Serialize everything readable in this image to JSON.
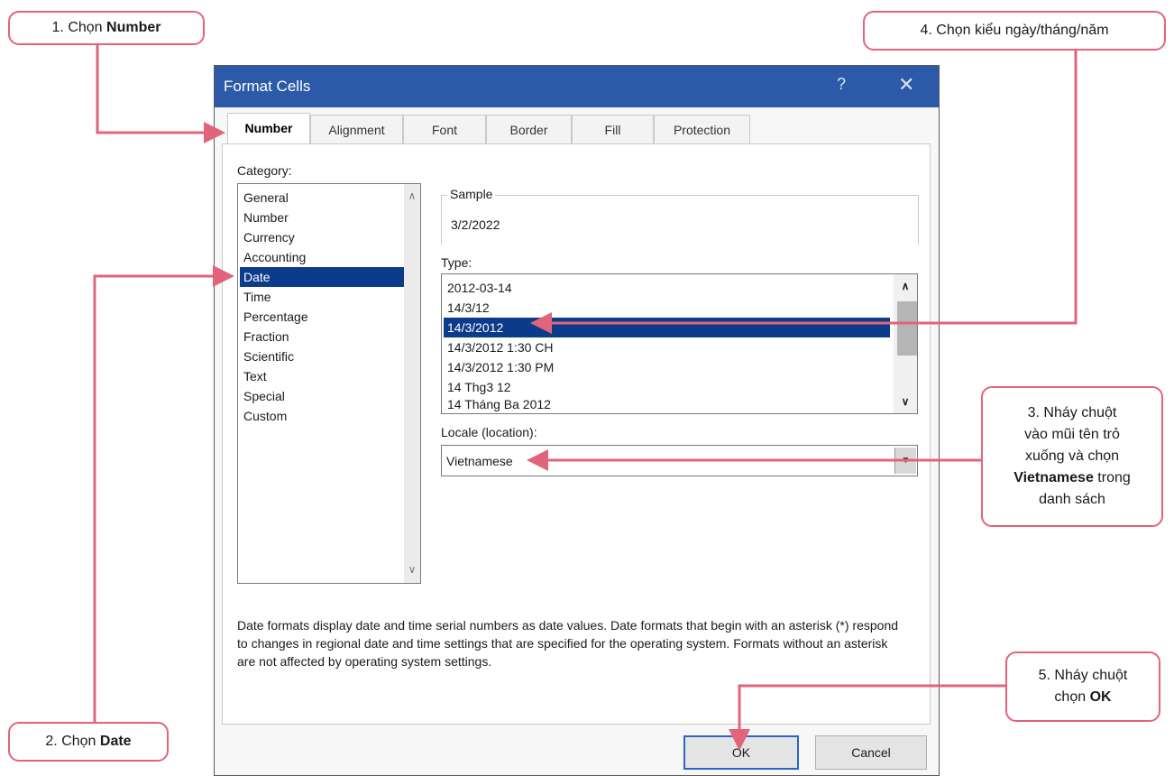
{
  "dialog": {
    "title": "Format Cells",
    "help_glyph": "?",
    "close_glyph": "✕",
    "tabs": [
      "Number",
      "Alignment",
      "Font",
      "Border",
      "Fill",
      "Protection"
    ],
    "active_tab": "Number",
    "category_label": "Category:",
    "categories": [
      "General",
      "Number",
      "Currency",
      "Accounting",
      "Date",
      "Time",
      "Percentage",
      "Fraction",
      "Scientific",
      "Text",
      "Special",
      "Custom"
    ],
    "selected_category": "Date",
    "sample_label": "Sample",
    "sample_value": "3/2/2022",
    "type_label": "Type:",
    "types": [
      "2012-03-14",
      "14/3/12",
      "14/3/2012",
      "14/3/2012 1:30 CH",
      "14/3/2012 1:30 PM",
      "14 Thg3 12",
      "14 Tháng Ba 2012"
    ],
    "selected_type": "14/3/2012",
    "locale_label": "Locale (location):",
    "locale_value": "Vietnamese",
    "description": "Date formats display date and time serial numbers as date values.  Date formats that begin with an asterisk (*) respond to changes in regional date and time settings that are specified for the operating system. Formats without an asterisk are not affected by operating system settings.",
    "ok_label": "OK",
    "cancel_label": "Cancel"
  },
  "callouts": {
    "c1_prefix": "1. Chọn ",
    "c1_bold": "Number",
    "c2_prefix": "2. Chọn ",
    "c2_bold": "Date",
    "c3_line1": "3. Nháy chuột",
    "c3_line2": "vào mũi tên trỏ",
    "c3_line3": "xuống và chọn",
    "c3_bold": "Vietnamese",
    "c3_after_bold": " trong",
    "c3_line5": "danh sách",
    "c4_text": "4. Chọn kiểu ngày/tháng/năm",
    "c5_line1": "5. Nháy chuột",
    "c5_prefix": "chọn ",
    "c5_bold": "OK"
  },
  "colors": {
    "callout_accent": "#e2647b",
    "title_bar": "#2c5aa8",
    "selection": "#0d3b8c"
  },
  "icons": {
    "scroll_up": "chevron-up-icon",
    "scroll_down": "chevron-down-icon",
    "dropdown": "chevron-down-icon"
  }
}
